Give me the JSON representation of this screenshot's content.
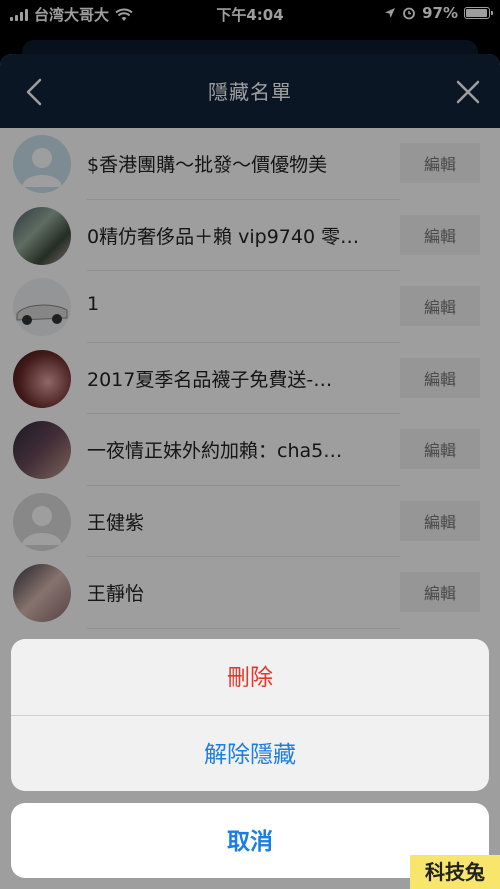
{
  "status": {
    "carrier": "台湾大哥大",
    "time": "下午4:04",
    "battery": "97%",
    "battery_level": 0.97
  },
  "nav": {
    "title": "隱藏名單",
    "back_icon": "chevron-left-icon",
    "close_icon": "close-icon"
  },
  "list": {
    "edit_label": "編輯",
    "items": [
      {
        "name": "$香港團購～批發～價優物美"
      },
      {
        "name": "0精仿奢侈品＋賴 vip9740 零…"
      },
      {
        "name": "1"
      },
      {
        "name": "2017夏季名品襪子免費送-…"
      },
      {
        "name": "一夜情正妹外約加賴：cha5…"
      },
      {
        "name": "王健紫"
      },
      {
        "name": "王靜怡"
      }
    ]
  },
  "action_sheet": {
    "delete_label": "刪除",
    "unhide_label": "解除隱藏",
    "cancel_label": "取消"
  },
  "watermark": "科技兔",
  "colors": {
    "nav_bg": "#13243d",
    "delete": "#e0392b",
    "action": "#1b7ee0"
  }
}
